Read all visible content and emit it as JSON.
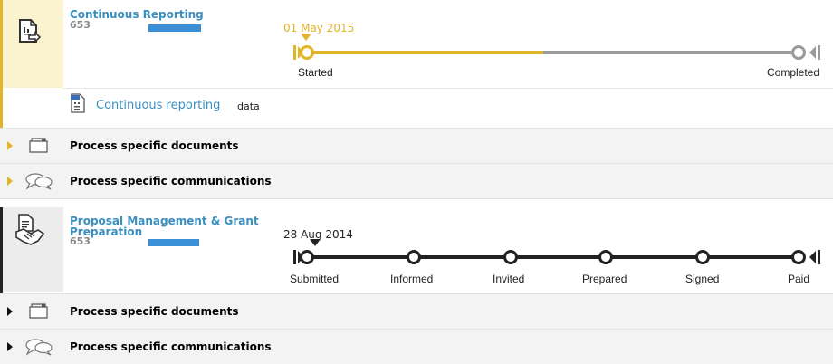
{
  "blocks": [
    {
      "title_lines": [
        "Continuous Reporting"
      ],
      "code_prefix": "653",
      "date": "01 May 2015",
      "accent": "#e2b42a",
      "steps": [
        "Started",
        "Completed"
      ],
      "progress": 0.5,
      "data_link": {
        "label": "Continuous reporting",
        "suffix": "data"
      },
      "sections": [
        "Process specific documents",
        "Process specific communications"
      ]
    },
    {
      "title_lines": [
        "Proposal Management & Grant",
        "Preparation"
      ],
      "code_prefix": "653",
      "date": "28 Aug 2014",
      "accent": "#222222",
      "steps": [
        "Submitted",
        "Informed",
        "Invited",
        "Prepared",
        "Signed",
        "Paid"
      ],
      "progress": 0,
      "sections": [
        "Process specific documents",
        "Process specific communications"
      ]
    }
  ]
}
